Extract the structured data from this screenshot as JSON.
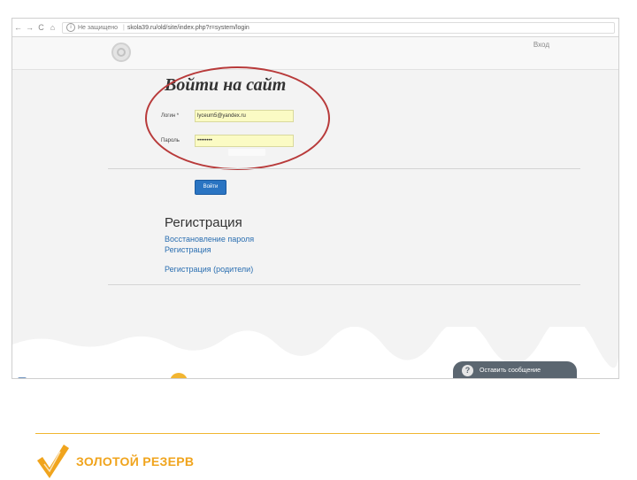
{
  "browser": {
    "back_icon": "←",
    "forward_icon": "→",
    "reload_icon": "C",
    "home_icon": "⌂",
    "security_icon": "i",
    "security_label": "Не защищено",
    "url": "skola39.ru/old/site/index.php?r=system/login"
  },
  "site": {
    "header_login_link": "Вход",
    "login_title": "Войти на сайт",
    "login_label": "Логин *",
    "login_value": "lyceum5@yandex.ru",
    "password_label": "Пароль",
    "password_value": "••••••••",
    "submit_label": "Войти",
    "registration_heading": "Регистрация",
    "links": {
      "password_recovery": "Восстановление пароля",
      "registration": "Регистрация",
      "registration_parents": "Регистрация (родители)"
    },
    "chat_icon": "?",
    "chat_label": "Оставить сообщение"
  },
  "footer": {
    "brand": "ЗОЛОТОЙ РЕЗЕРВ"
  },
  "colors": {
    "accent_blue": "#2a74c2",
    "highlight_red": "#b83a3a",
    "brand_orange": "#f0a41d",
    "input_yellow": "#fbfbc4"
  }
}
